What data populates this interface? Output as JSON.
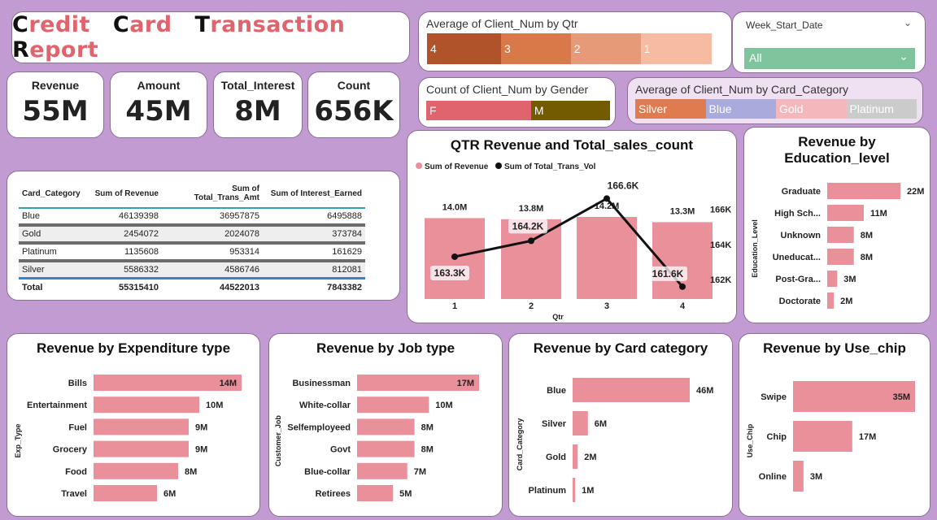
{
  "title": {
    "parts": [
      [
        "C",
        "redit"
      ],
      [
        "C",
        "ard"
      ],
      [
        "T",
        "ransaction"
      ],
      [
        "R",
        "eport"
      ]
    ]
  },
  "kpis": [
    {
      "label": "Revenue",
      "value": "55M"
    },
    {
      "label": "Amount",
      "value": "45M"
    },
    {
      "label": "Total_Interest",
      "value": "8M"
    },
    {
      "label": "Count",
      "value": "656K"
    }
  ],
  "qtr_slicer": {
    "title": "Average of Client_Num by Qtr",
    "items": [
      {
        "label": "4",
        "color": "#b1532a",
        "share": 0.26
      },
      {
        "label": "3",
        "color": "#d9794a",
        "share": 0.245
      },
      {
        "label": "2",
        "color": "#e79a77",
        "share": 0.245
      },
      {
        "label": "1",
        "color": "#f5bca2",
        "share": 0.25
      }
    ]
  },
  "week_slicer": {
    "title": "Week_Start_Date",
    "value": "All"
  },
  "gender_slicer": {
    "title": "Count of Client_Num by Gender",
    "items": [
      {
        "label": "F",
        "color": "#e0646e",
        "share": 0.57
      },
      {
        "label": "M",
        "color": "#725b00",
        "share": 0.43
      }
    ]
  },
  "card_slicer": {
    "title": "Average of Client_Num by Card_Category",
    "items": [
      {
        "label": "Silver",
        "color": "#e07a4f"
      },
      {
        "label": "Blue",
        "color": "#a9abdc"
      },
      {
        "label": "Gold",
        "color": "#f4b7bb"
      },
      {
        "label": "Platinum",
        "color": "#cbcbcb"
      }
    ]
  },
  "table": {
    "headers": [
      "Card_Category",
      "Sum of Revenue",
      "Sum of Total_Trans_Amt",
      "Sum of Interest_Earned"
    ],
    "rows": [
      [
        "Blue",
        "46139398",
        "36957875",
        "6495888"
      ],
      [
        "Gold",
        "2454072",
        "2024078",
        "373784"
      ],
      [
        "Platinum",
        "1135608",
        "953314",
        "161629"
      ],
      [
        "Silver",
        "5586332",
        "4586746",
        "812081"
      ]
    ],
    "total": [
      "Total",
      "55315410",
      "44522013",
      "7843382"
    ]
  },
  "colors": {
    "bar": "#e9909a",
    "line": "#111111"
  },
  "chart_data": [
    {
      "id": "qtr",
      "type": "bar",
      "title": "QTR Revenue and Total_sales_count",
      "xlabel": "Qtr",
      "categories": [
        "1",
        "2",
        "3",
        "4"
      ],
      "series": [
        {
          "name": "Sum of Revenue",
          "type": "bar",
          "values": [
            14.0,
            13.8,
            14.2,
            13.3
          ],
          "labels": [
            "14.0M",
            "13.8M",
            "14.2M",
            "13.3M"
          ]
        },
        {
          "name": "Sum of Total_Trans_Vol",
          "type": "line",
          "values": [
            163.3,
            164.2,
            166.6,
            161.6
          ],
          "labels": [
            "163.3K",
            "164.2K",
            "166.6K",
            "161.6K"
          ]
        }
      ],
      "y2_ticks": [
        "162K",
        "164K",
        "166K"
      ],
      "y2_tick_values": [
        162,
        164,
        166
      ],
      "y2lim": [
        160.9,
        167.4
      ],
      "legend": "top-left"
    },
    {
      "id": "edu",
      "type": "bar",
      "title": "Revenue by Education_level",
      "ylabel": "Education_Level",
      "categories": [
        "Graduate",
        "High Sch...",
        "Unknown",
        "Uneducat...",
        "Post-Gra...",
        "Doctorate"
      ],
      "values": [
        22,
        11,
        8,
        8,
        3,
        2
      ],
      "labels": [
        "22M",
        "11M",
        "8M",
        "8M",
        "3M",
        "2M"
      ]
    },
    {
      "id": "exp",
      "type": "bar",
      "title": "Revenue by Expenditure type",
      "ylabel": "Exp_Type",
      "categories": [
        "Bills",
        "Entertainment",
        "Fuel",
        "Grocery",
        "Food",
        "Travel"
      ],
      "values": [
        14,
        10,
        9,
        9,
        8,
        6
      ],
      "labels": [
        "14M",
        "10M",
        "9M",
        "9M",
        "8M",
        "6M"
      ]
    },
    {
      "id": "job",
      "type": "bar",
      "title": "Revenue by Job type",
      "ylabel": "Customer_Job",
      "categories": [
        "Businessman",
        "White-collar",
        "Selfemployeed",
        "Govt",
        "Blue-collar",
        "Retirees"
      ],
      "values": [
        17,
        10,
        8,
        8,
        7,
        5
      ],
      "labels": [
        "17M",
        "10M",
        "8M",
        "8M",
        "7M",
        "5M"
      ]
    },
    {
      "id": "card",
      "type": "bar",
      "title": "Revenue by Card category",
      "ylabel": "Card_Category",
      "categories": [
        "Blue",
        "Silver",
        "Gold",
        "Platinum"
      ],
      "values": [
        46,
        6,
        2,
        1
      ],
      "labels": [
        "46M",
        "6M",
        "2M",
        "1M"
      ]
    },
    {
      "id": "chip",
      "type": "bar",
      "title": "Revenue by Use_chip",
      "ylabel": "Use_Chip",
      "categories": [
        "Swipe",
        "Chip",
        "Online"
      ],
      "values": [
        35,
        17,
        3
      ],
      "labels": [
        "35M",
        "17M",
        "3M"
      ]
    }
  ]
}
